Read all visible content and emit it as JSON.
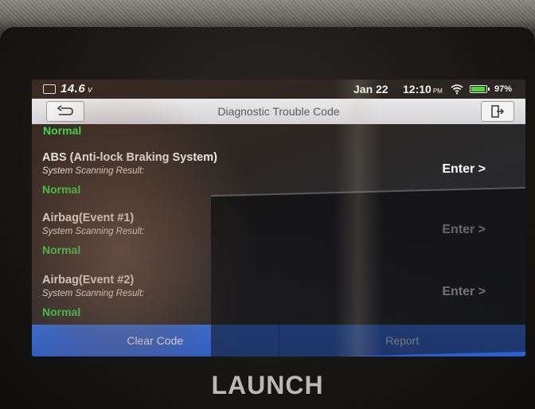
{
  "status_bar": {
    "voltage": "14.6",
    "voltage_unit": "v",
    "date": "Jan 22",
    "time": "12:10",
    "ampm": "PM",
    "battery_percent": "97%",
    "battery_level": 0.97,
    "icons": [
      "battery-voltage-icon",
      "wifi-icon",
      "battery-icon"
    ]
  },
  "title_bar": {
    "title": "Diagnostic Trouble Code",
    "back_icon": "back-arrow-icon",
    "exit_icon": "exit-icon"
  },
  "list": {
    "partial_status": "Normal",
    "items": [
      {
        "name": "ABS (Anti-lock Braking System)",
        "result_label": "System Scanning Result:",
        "status": "Normal",
        "enter": "Enter >"
      },
      {
        "name": "Airbag(Event #1)",
        "result_label": "System Scanning Result:",
        "status": "Normal",
        "enter": "Enter >"
      },
      {
        "name": "Airbag(Event #2)",
        "result_label": "System Scanning Result:",
        "status": "Normal",
        "enter": "Enter >"
      }
    ]
  },
  "buttons": {
    "clear_code": "Clear Code",
    "report": "Report"
  },
  "brand": "LAUNCH",
  "colors": {
    "status_ok": "#35e449",
    "button_blue": "#2f6fe6",
    "title_bar": "#e2e2e4"
  }
}
